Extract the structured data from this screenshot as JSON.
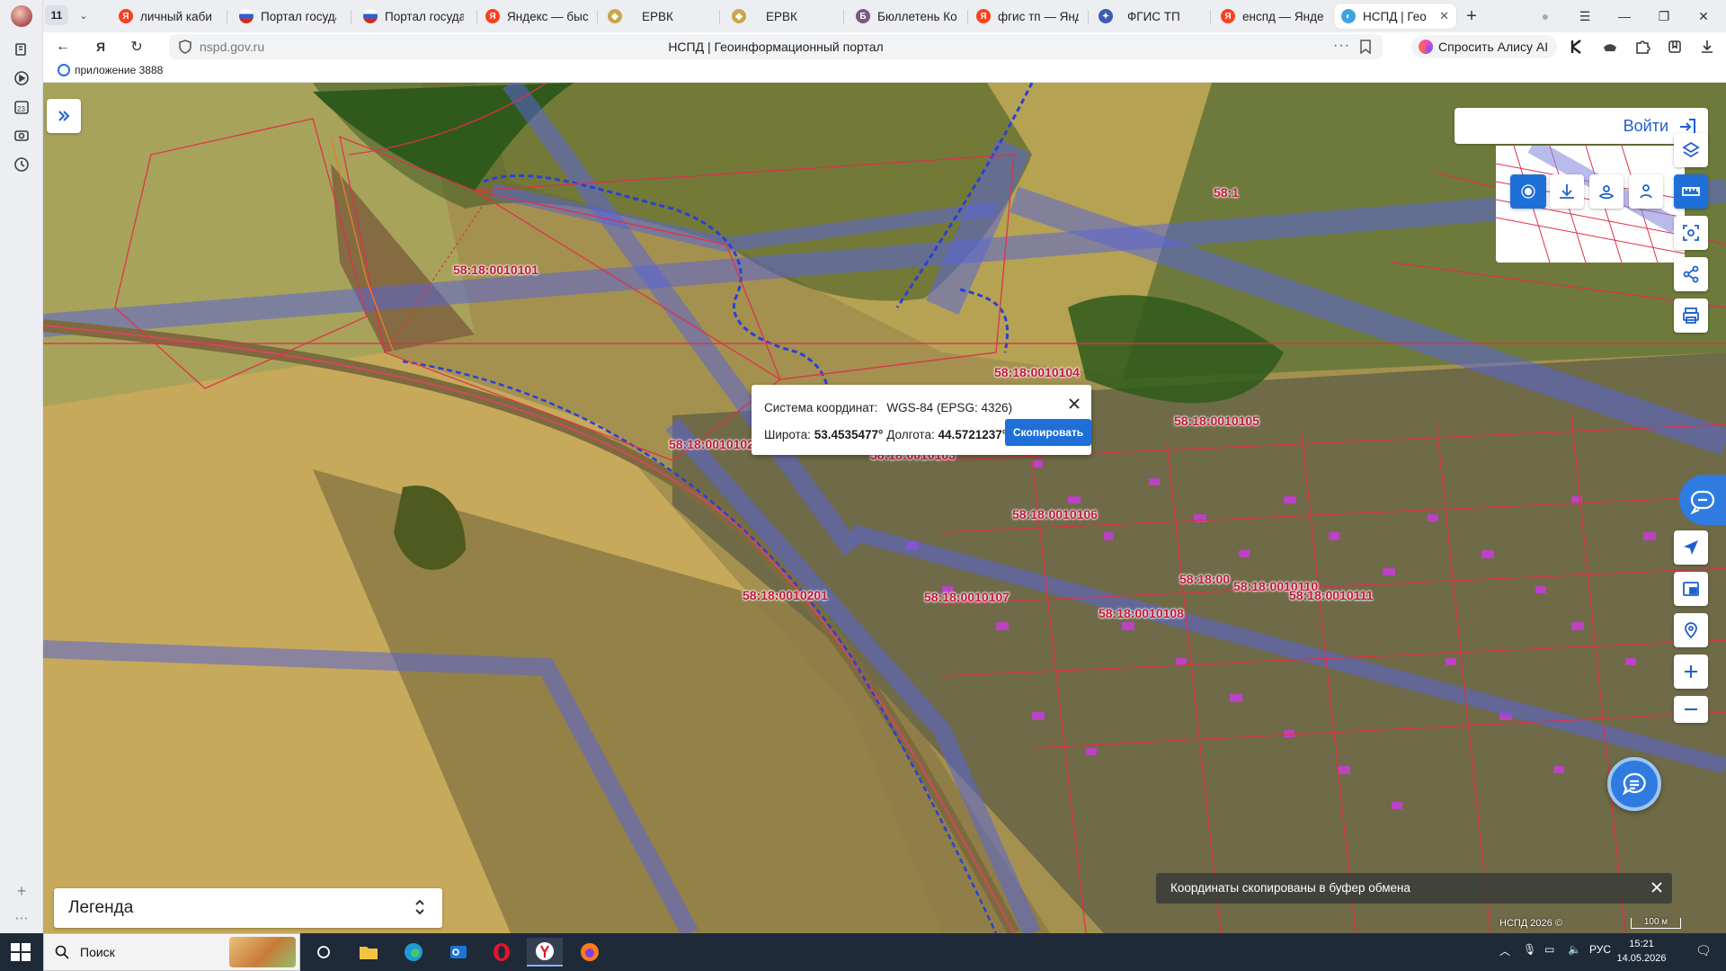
{
  "browser": {
    "tab_count": "11",
    "tabs": [
      {
        "label": "личный кабине",
        "favicon": "yandex-icon"
      },
      {
        "label": "Портал госуда",
        "favicon": "russia-flag-icon"
      },
      {
        "label": "Портал госуда",
        "favicon": "russia-flag-icon"
      },
      {
        "label": "Яндекс — быст",
        "favicon": "yandex-icon"
      },
      {
        "label": "ЕРВК",
        "favicon": "emblem-icon"
      },
      {
        "label": "ЕРВК",
        "favicon": "emblem-icon"
      },
      {
        "label": "Бюллетень Ко",
        "favicon": "bulletin-icon"
      },
      {
        "label": "фгис тп — Янд",
        "favicon": "yandex-icon"
      },
      {
        "label": "ФГИС ТП",
        "favicon": "eagle-icon"
      },
      {
        "label": "енспд — Яндек",
        "favicon": "yandex-icon"
      },
      {
        "label": "НСПД | Геои",
        "favicon": "nspd-icon",
        "active": true
      }
    ],
    "url": "nspd.gov.ru",
    "page_title": "НСПД | Геоинформационный портал",
    "alice_button": "Спросить Алису AI",
    "bookmark": "приложение 3888"
  },
  "map": {
    "login_label": "Войти",
    "cadastral_labels": [
      "58:18:0010101",
      "58:18:0010102",
      "58:18:0010103",
      "58:18:0010104",
      "58:18:0010105",
      "58:18:0010106",
      "58:18:0010107",
      "58:18:0010108",
      "58:18:0010110",
      "58:18:0010111",
      "58:18:0010201",
      "58:18:00",
      "58:1"
    ],
    "popup": {
      "crs_label": "Система координат:",
      "crs_value": "WGS-84 (EPSG: 4326)",
      "lat_label": "Широта:",
      "lat_value": "53.4535477°",
      "lon_label": "Долгота:",
      "lon_value": "44.5721237°",
      "copy_button": "Скопировать"
    },
    "legend_label": "Легенда",
    "toast": "Координаты скопированы в буфер обмена",
    "attribution": "НСПД 2026 ©",
    "scale": "100 м",
    "colors": {
      "accent": "#1f6fd9",
      "parcel_border": "#e0304a",
      "zone_overlay": "#5a64d6"
    }
  },
  "taskbar": {
    "search_label": "Поиск",
    "language": "РУС",
    "time": "15:21",
    "date": "14.05.2026"
  }
}
